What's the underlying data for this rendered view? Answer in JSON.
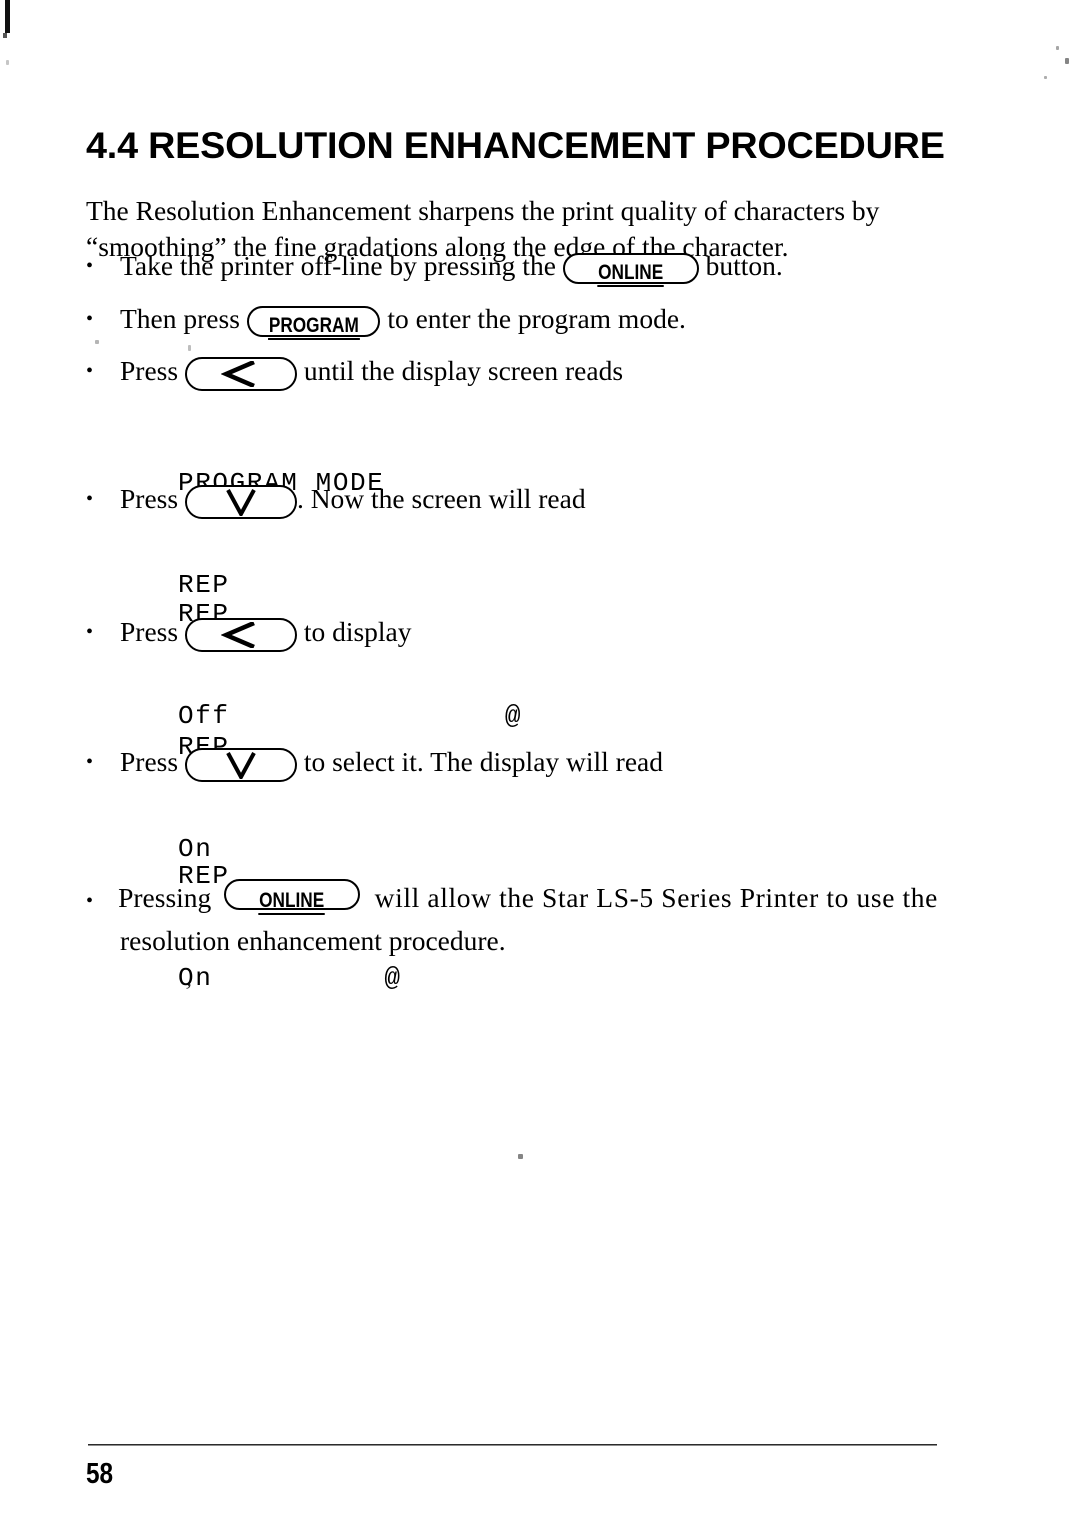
{
  "document": {
    "section_title": "4.4 RESOLUTION ENHANCEMENT PROCEDURE",
    "page_number": "58"
  },
  "intro": {
    "line1": "The Resolution Enhancement sharpens the print quality of characters by",
    "line2": "“smoothing” the fine gradations along the edge of the character."
  },
  "keys": {
    "online": "ONLINE",
    "program": "PROGRAM",
    "left": "<",
    "down": "V"
  },
  "steps": [
    {
      "id": "step-offline",
      "before": "Take the printer off-line by pressing the",
      "key": "ONLINE",
      "after": "button."
    },
    {
      "id": "step-program",
      "before": "Then press",
      "key": "PROGRAM",
      "after": "to enter the program mode."
    },
    {
      "id": "step-press-left-1",
      "before": "Press",
      "key": "<",
      "after": "until the display screen reads"
    },
    {
      "id": "step-press-down-1",
      "before": "Press",
      "key": "V",
      "after": ". Now the screen will read"
    },
    {
      "id": "step-press-left-2",
      "before": "Press",
      "key": "<",
      "after": "to display"
    },
    {
      "id": "step-press-down-2",
      "before": "Press",
      "key": "V",
      "after": "to select it. The display will read"
    }
  ],
  "final_step": {
    "id": "step-pressing-online",
    "before": "Pressing",
    "key": "ONLINE",
    "after_line1": "will allow the Star LS-5 Series Printer to use the",
    "after_line2": "resolution enhancement procedure."
  },
  "displays": [
    {
      "id": "display-program-mode",
      "line1": "PROGRAM MODE",
      "line2": "REP"
    },
    {
      "id": "display-rep-off",
      "line1": "REP",
      "line2": "Off                @"
    },
    {
      "id": "display-rep-on",
      "line1": "REP",
      "line2": "On"
    },
    {
      "id": "display-rep-on-selected",
      "line1": "REP",
      "line2": "On          @"
    }
  ]
}
